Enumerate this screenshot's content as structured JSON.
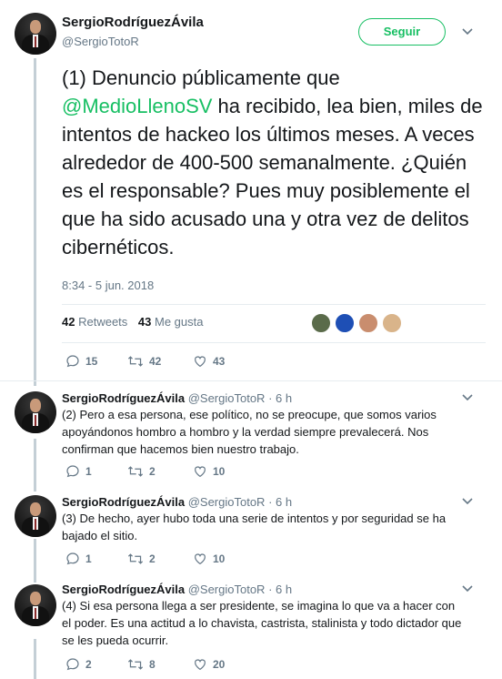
{
  "main_tweet": {
    "author_name": "SergioRodríguezÁvila",
    "author_handle": "@SergioTotoR",
    "follow_label": "Seguir",
    "text_prefix": "(1) Denuncio públicamente que",
    "mention": "@MedioLlenoSV",
    "text_suffix": " ha recibido, lea bien, miles de intentos de hackeo los últimos meses. A veces alrededor de 400-500 semanalmente. ¿Quién es el responsable? Pues muy posiblemente el que ha sido acusado una y otra vez de delitos cibernéticos.",
    "timestamp": "8:34 - 5 jun. 2018",
    "retweets_count": "42",
    "retweets_label": "Retweets",
    "likes_count": "43",
    "likes_label": "Me gusta",
    "replies": "15",
    "retweets": "42",
    "likes": "43"
  },
  "replies": [
    {
      "author_name": "SergioRodríguezÁvila",
      "author_handle": "@SergioTotoR",
      "time": "· 6 h",
      "text": "(2) Pero a esa persona, ese político, no se preocupe, que somos varios apoyándonos hombro a hombro y la verdad siempre prevalecerá. Nos confirman que hacemos bien nuestro trabajo.",
      "replies": "1",
      "retweets": "2",
      "likes": "10"
    },
    {
      "author_name": "SergioRodríguezÁvila",
      "author_handle": "@SergioTotoR",
      "time": "· 6 h",
      "text": "(3) De hecho, ayer hubo toda una serie de intentos y por seguridad se ha bajado el sitio.",
      "replies": "1",
      "retweets": "2",
      "likes": "10"
    },
    {
      "author_name": "SergioRodríguezÁvila",
      "author_handle": "@SergioTotoR",
      "time": "· 6 h",
      "text": "(4) Si esa persona llega a ser presidente, se imagina lo que va a hacer con el poder. Es una actitud a lo chavista, castrista, stalinista y todo dictador que se les pueda ocurrir.",
      "replies": "2",
      "retweets": "8",
      "likes": "20"
    }
  ],
  "liker_avatar_colors": [
    "#5a6b4a",
    "#1e4fb5",
    "#c98d6e",
    "#d9b48a"
  ],
  "colors": {
    "accent_green": "#17bf63",
    "muted": "#657786",
    "thread_line": "#c4cfd6"
  }
}
